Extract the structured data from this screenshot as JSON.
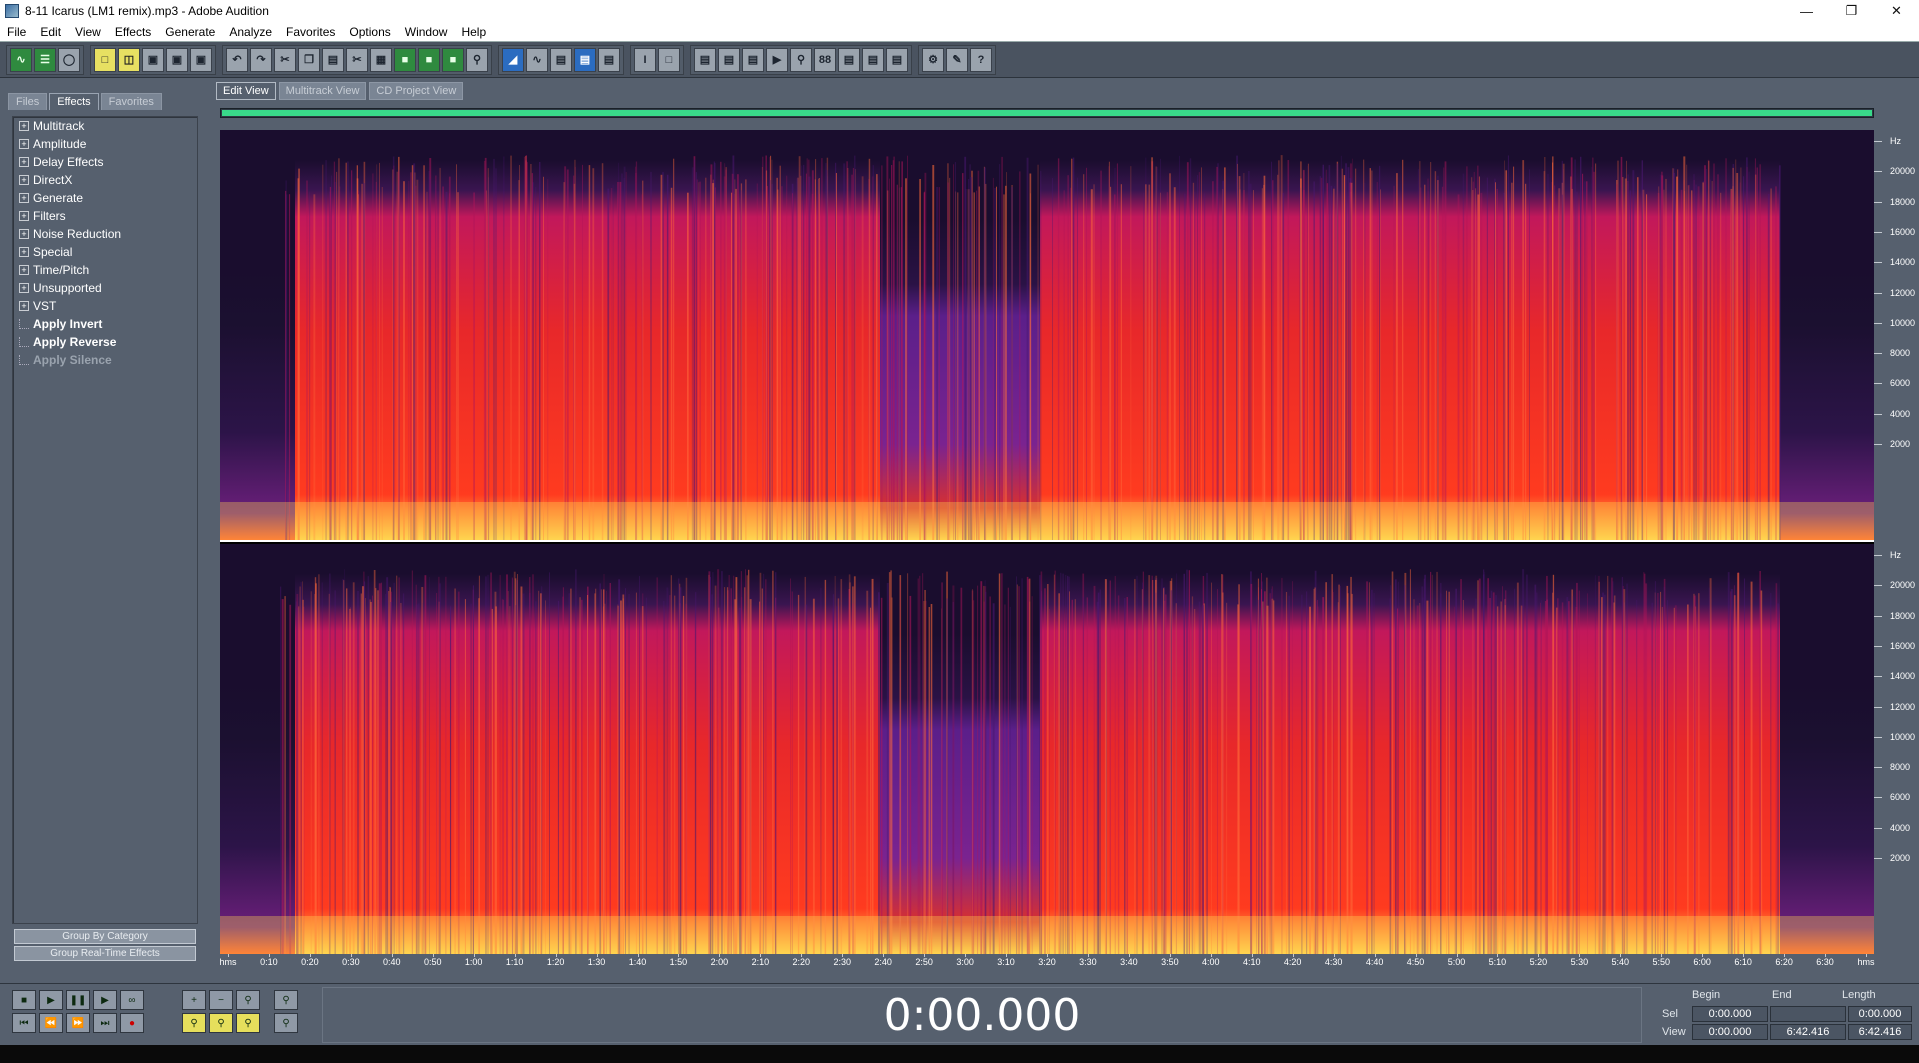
{
  "window": {
    "title": "8-11 Icarus (LM1 remix).mp3 - Adobe Audition"
  },
  "menu": [
    "File",
    "Edit",
    "View",
    "Effects",
    "Generate",
    "Analyze",
    "Favorites",
    "Options",
    "Window",
    "Help"
  ],
  "left_panel": {
    "tabs": [
      "Files",
      "Effects",
      "Favorites"
    ],
    "active_tab": "Effects",
    "tree": [
      {
        "label": "Multitrack",
        "type": "folder"
      },
      {
        "label": "Amplitude",
        "type": "folder"
      },
      {
        "label": "Delay Effects",
        "type": "folder"
      },
      {
        "label": "DirectX",
        "type": "folder"
      },
      {
        "label": "Generate",
        "type": "folder"
      },
      {
        "label": "Filters",
        "type": "folder"
      },
      {
        "label": "Noise Reduction",
        "type": "folder"
      },
      {
        "label": "Special",
        "type": "folder"
      },
      {
        "label": "Time/Pitch",
        "type": "folder"
      },
      {
        "label": "Unsupported",
        "type": "folder"
      },
      {
        "label": "VST",
        "type": "folder"
      },
      {
        "label": "Apply Invert",
        "type": "leaf"
      },
      {
        "label": "Apply Reverse",
        "type": "leaf"
      },
      {
        "label": "Apply Silence",
        "type": "leaf-disabled"
      }
    ],
    "group_by_category": "Group By Category",
    "group_realtime": "Group Real-Time Effects"
  },
  "view_tabs": [
    "Edit View",
    "Multitrack View",
    "CD Project View"
  ],
  "active_view_tab": "Edit View",
  "hz_labels": [
    "Hz",
    "20000",
    "18000",
    "16000",
    "14000",
    "12000",
    "10000",
    "8000",
    "6000",
    "4000",
    "2000"
  ],
  "time_labels": [
    "hms",
    "0:10",
    "0:20",
    "0:30",
    "0:40",
    "0:50",
    "1:00",
    "1:10",
    "1:20",
    "1:30",
    "1:40",
    "1:50",
    "2:00",
    "2:10",
    "2:20",
    "2:30",
    "2:40",
    "2:50",
    "3:00",
    "3:10",
    "3:20",
    "3:30",
    "3:40",
    "3:50",
    "4:00",
    "4:10",
    "4:20",
    "4:30",
    "4:40",
    "4:50",
    "5:00",
    "5:10",
    "5:20",
    "5:30",
    "5:40",
    "5:50",
    "6:00",
    "6:10",
    "6:20",
    "6:30",
    "hms"
  ],
  "transport": {
    "time": "0:00.000"
  },
  "selection": {
    "headers": [
      "Begin",
      "End",
      "Length"
    ],
    "sel_label": "Sel",
    "view_label": "View",
    "sel": {
      "begin": "0:00.000",
      "end": "",
      "length": "0:00.000"
    },
    "view": {
      "begin": "0:00.000",
      "end": "6:42.416",
      "length": "6:42.416"
    }
  },
  "colors": {
    "spectrum_low": "#1a0d2e",
    "spectrum_mid": "#c2185b",
    "spectrum_high": "#ff3b1f",
    "spectrum_peak": "#ffd54f",
    "overview": "#39d98a",
    "panel_bg": "#56606e"
  }
}
